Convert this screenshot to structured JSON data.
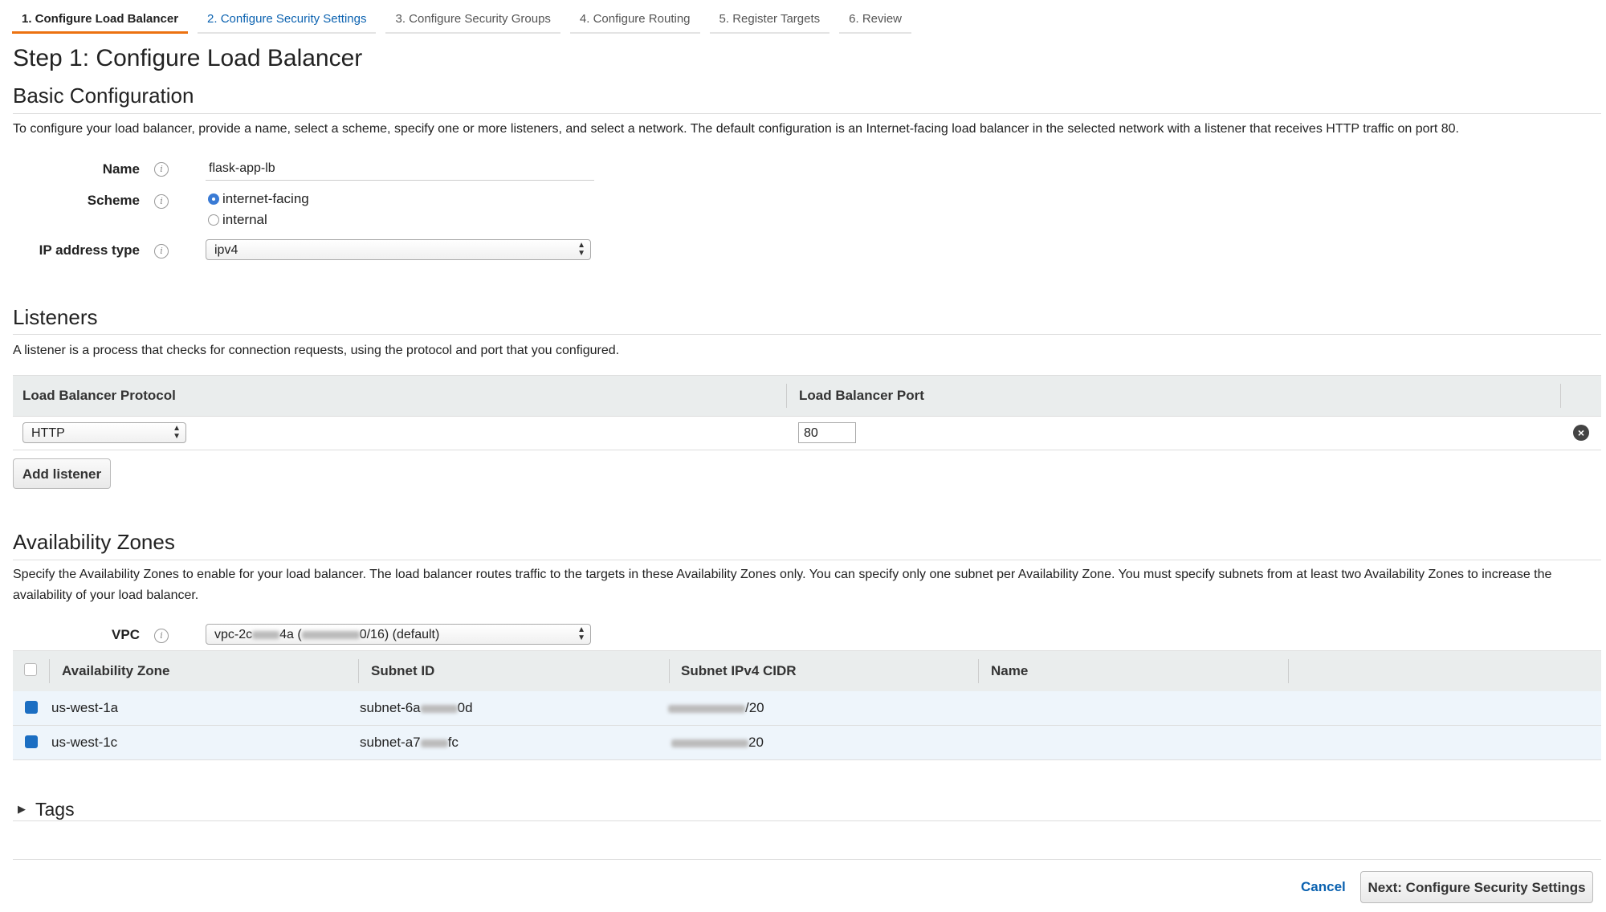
{
  "tabs": [
    {
      "label": "1. Configure Load Balancer"
    },
    {
      "label": "2. Configure Security Settings"
    },
    {
      "label": "3. Configure Security Groups"
    },
    {
      "label": "4. Configure Routing"
    },
    {
      "label": "5. Register Targets"
    },
    {
      "label": "6. Review"
    }
  ],
  "page_title": "Step 1: Configure Load Balancer",
  "basic": {
    "heading": "Basic Configuration",
    "description": "To configure your load balancer, provide a name, select a scheme, specify one or more listeners, and select a network. The default configuration is an Internet-facing load balancer in the selected network with a listener that receives HTTP traffic on port 80.",
    "name_label": "Name",
    "name_value": "flask-app-lb",
    "scheme_label": "Scheme",
    "scheme_options": [
      "internet-facing",
      "internal"
    ],
    "ip_type_label": "IP address type",
    "ip_type_value": "ipv4"
  },
  "listeners": {
    "heading": "Listeners",
    "description": "A listener is a process that checks for connection requests, using the protocol and port that you configured.",
    "col_protocol": "Load Balancer Protocol",
    "col_port": "Load Balancer Port",
    "protocol_value": "HTTP",
    "port_value": "80",
    "add_button": "Add listener"
  },
  "az": {
    "heading": "Availability Zones",
    "description": "Specify the Availability Zones to enable for your load balancer. The load balancer routes traffic to the targets in these Availability Zones only. You can specify only one subnet per Availability Zone. You must specify subnets from at least two Availability Zones to increase the availability of your load balancer.",
    "vpc_label": "VPC",
    "vpc_prefix": "vpc-2c",
    "vpc_mid": "4a (",
    "vpc_suffix": "0/16) (default)",
    "columns": [
      "Availability Zone",
      "Subnet ID",
      "Subnet IPv4 CIDR",
      "Name"
    ],
    "rows": [
      {
        "zone": "us-west-1a",
        "subnet_prefix": "subnet-6a",
        "subnet_suffix": "0d",
        "cidr_suffix": "/20"
      },
      {
        "zone": "us-west-1c",
        "subnet_prefix": "subnet-a7",
        "subnet_suffix": "fc",
        "cidr_suffix": "20"
      }
    ]
  },
  "tags": {
    "label": "Tags"
  },
  "footer": {
    "cancel": "Cancel",
    "next": "Next: Configure Security Settings"
  }
}
